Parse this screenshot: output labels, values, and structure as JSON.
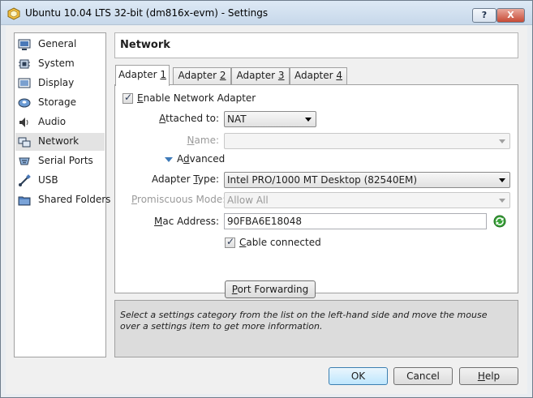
{
  "window": {
    "title": "Ubuntu 10.04 LTS 32-bit (dm816x-evm) - Settings",
    "help_label": "?",
    "close_label": "X"
  },
  "sidebar": {
    "items": [
      {
        "label": "General",
        "icon": "monitor-icon"
      },
      {
        "label": "System",
        "icon": "chip-icon"
      },
      {
        "label": "Display",
        "icon": "display-icon"
      },
      {
        "label": "Storage",
        "icon": "disc-icon"
      },
      {
        "label": "Audio",
        "icon": "speaker-icon"
      },
      {
        "label": "Network",
        "icon": "network-icon",
        "selected": true
      },
      {
        "label": "Serial Ports",
        "icon": "serial-port-icon"
      },
      {
        "label": "USB",
        "icon": "usb-icon"
      },
      {
        "label": "Shared Folders",
        "icon": "folder-icon"
      }
    ]
  },
  "header": {
    "title": "Network"
  },
  "tabs": [
    {
      "label": "Adapter ",
      "mnemonic": "1",
      "active": true
    },
    {
      "label": "Adapter ",
      "mnemonic": "2"
    },
    {
      "label": "Adapter ",
      "mnemonic": "3"
    },
    {
      "label": "Adapter ",
      "mnemonic": "4"
    }
  ],
  "adapter": {
    "enable_label_prefix": "",
    "enable_label_mnemonic": "E",
    "enable_label_rest": "nable Network Adapter",
    "enable_checked": true,
    "attached_label_prefix": "",
    "attached_label_mnemonic": "A",
    "attached_label_rest": "ttached to:",
    "attached_value": "NAT",
    "name_label_prefix": "",
    "name_label_mnemonic": "N",
    "name_label_rest": "ame:",
    "name_value": "",
    "advanced_label_mnemonic": "d",
    "advanced_label_prefix": "A",
    "advanced_label_rest": "vanced",
    "type_label_prefix": "Adapter ",
    "type_label_mnemonic": "T",
    "type_label_rest": "ype:",
    "type_value": "Intel PRO/1000 MT Desktop (82540EM)",
    "promiscuous_label_prefix": "",
    "promiscuous_label_mnemonic": "P",
    "promiscuous_label_rest": "romiscuous Mode:",
    "promiscuous_value": "Allow All",
    "mac_label_prefix": "",
    "mac_label_mnemonic": "M",
    "mac_label_rest": "ac Address:",
    "mac_value": "90FBA6E18048",
    "cable_label_mnemonic": "C",
    "cable_label_rest": "able connected",
    "cable_checked": true,
    "port_forwarding_mnemonic": "P",
    "port_forwarding_rest": "ort Forwarding"
  },
  "info": {
    "text": "Select a settings category from the list on the left-hand side and move the mouse over a settings item to get more information."
  },
  "footer": {
    "ok_label": "OK",
    "cancel_label": "Cancel",
    "help_mnemonic": "H",
    "help_rest": "elp"
  }
}
